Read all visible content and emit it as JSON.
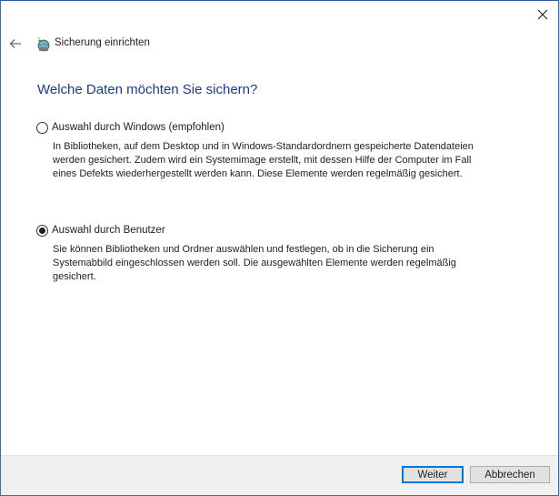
{
  "window": {
    "title": "Sicherung einrichten",
    "close_icon": "close-icon",
    "back_icon": "back-arrow-icon",
    "app_icon": "backup-icon"
  },
  "main": {
    "heading": "Welche Daten möchten Sie sichern?",
    "options": [
      {
        "label": "Auswahl durch Windows (empfohlen)",
        "selected": false,
        "description_lines": [
          "In Bibliotheken, auf dem Desktop und in Windows-Standardordnern gespeicherte Datendateien",
          "werden gesichert. Zudem wird ein Systemimage erstellt, mit dessen Hilfe der Computer im Fall",
          "eines Defekts wiederhergestellt werden kann. Diese Elemente werden regelmäßig gesichert."
        ]
      },
      {
        "label": "Auswahl durch Benutzer",
        "selected": true,
        "description_lines": [
          "Sie können Bibliotheken und Ordner auswählen und festlegen, ob in die Sicherung ein",
          "Systemabbild eingeschlossen werden soll. Die ausgewählten Elemente werden regelmäßig",
          "gesichert."
        ]
      }
    ]
  },
  "footer": {
    "next_label": "Weiter",
    "cancel_label": "Abbrechen"
  },
  "colors": {
    "heading": "#1c3a93",
    "accent": "#0078d7",
    "footer_bg": "#f0f0f0"
  }
}
